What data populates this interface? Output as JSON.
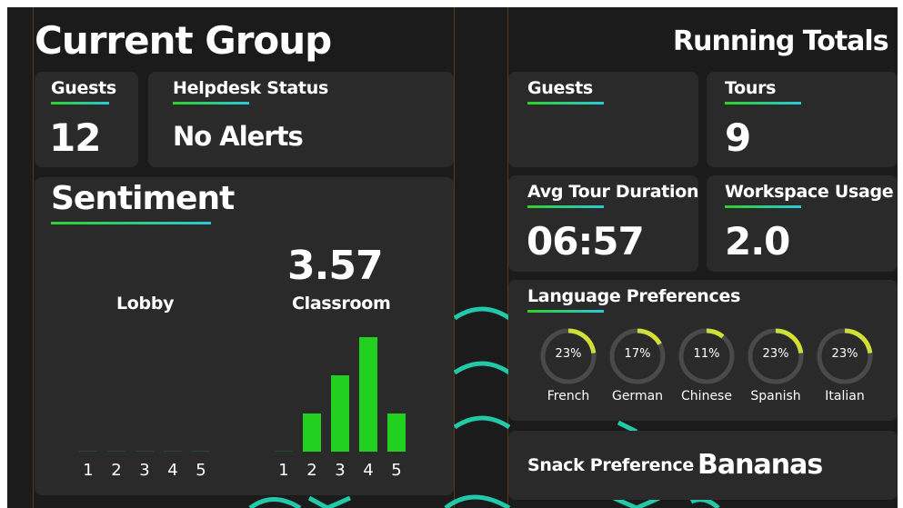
{
  "current_group": {
    "title": "Current Group",
    "guests": {
      "label": "Guests",
      "value": "12"
    },
    "helpdesk": {
      "label": "Helpdesk Status",
      "value": "No Alerts"
    },
    "sentiment": {
      "title": "Sentiment",
      "score": "3.57"
    }
  },
  "running_totals": {
    "title": "Running Totals",
    "guests": {
      "label": "Guests",
      "value": ""
    },
    "tours": {
      "label": "Tours",
      "value": "9"
    },
    "avg_tour_duration": {
      "label": "Avg Tour Duration",
      "value": "06:57"
    },
    "workspace_usage": {
      "label": "Workspace Usage",
      "value": "2.0"
    },
    "language_preferences": {
      "title": "Language Preferences",
      "languages": [
        {
          "name": "French",
          "percent": 23,
          "percent_label": "23%"
        },
        {
          "name": "German",
          "percent": 17,
          "percent_label": "17%"
        },
        {
          "name": "Chinese",
          "percent": 11,
          "percent_label": "11%"
        },
        {
          "name": "Spanish",
          "percent": 23,
          "percent_label": "23%"
        },
        {
          "name": "Italian",
          "percent": 23,
          "percent_label": "23%"
        }
      ]
    },
    "snack": {
      "label": "Snack Preference",
      "value": "Bananas"
    }
  },
  "colors": {
    "accent_green": "#2ed12a",
    "accent_cyan": "#2bc8d6",
    "ring_yellow": "#f2e416",
    "card_bg": "#2a2a2a"
  },
  "chart_data": [
    {
      "type": "bar",
      "title": "Lobby",
      "categories": [
        "1",
        "2",
        "3",
        "4",
        "5"
      ],
      "values": [
        0,
        0,
        0,
        0,
        0
      ],
      "ylim": [
        0,
        3
      ]
    },
    {
      "type": "bar",
      "title": "Classroom",
      "categories": [
        "1",
        "2",
        "3",
        "4",
        "5"
      ],
      "values": [
        0,
        1,
        2,
        3,
        1
      ],
      "ylim": [
        0,
        3
      ]
    }
  ]
}
